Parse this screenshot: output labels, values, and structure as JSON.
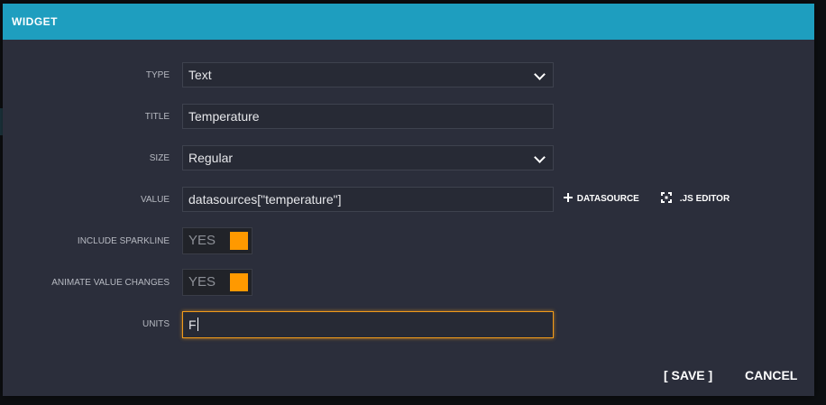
{
  "modal": {
    "title": "WIDGET"
  },
  "form": {
    "type": {
      "label": "TYPE",
      "value": "Text"
    },
    "title": {
      "label": "TITLE",
      "value": "Temperature"
    },
    "size": {
      "label": "SIZE",
      "value": "Regular"
    },
    "value": {
      "label": "VALUE",
      "value": "datasources[\"temperature\"]",
      "datasource_button": "DATASOURCE",
      "js_editor_button": ".JS EDITOR"
    },
    "include_sparkline": {
      "label": "INCLUDE SPARKLINE",
      "toggle": "YES"
    },
    "animate_value_changes": {
      "label": "ANIMATE VALUE CHANGES",
      "toggle": "YES"
    },
    "units": {
      "label": "UNITS",
      "value": "F"
    }
  },
  "footer": {
    "save": "[ SAVE ]",
    "cancel": "CANCEL"
  },
  "colors": {
    "header": "#1e9ebf",
    "dialog_bg": "#2b2e3b",
    "accent": "#ff9900",
    "focus_border": "#f29b1a"
  },
  "icons": {
    "dropdown": "chevron-down-icon",
    "datasource": "plus-icon",
    "js_editor": "expand-icon"
  }
}
